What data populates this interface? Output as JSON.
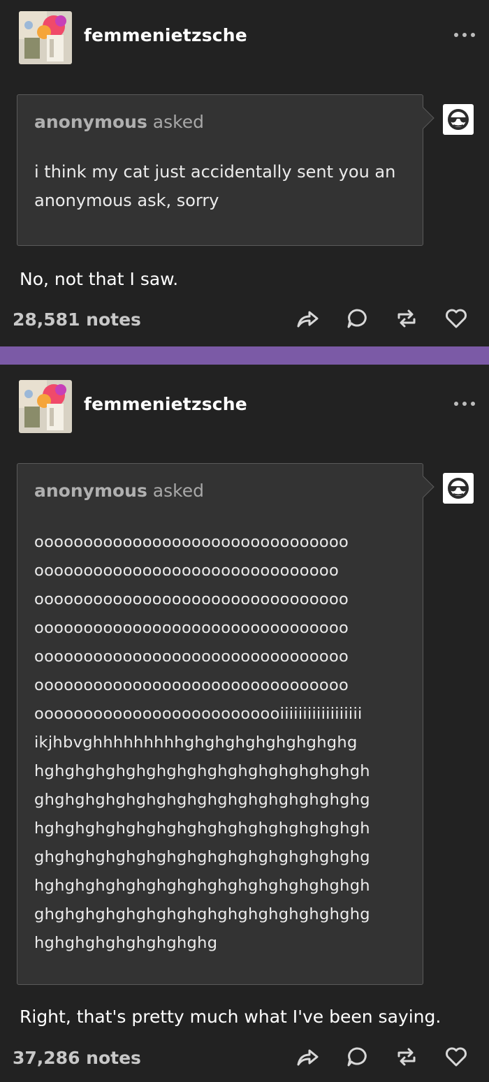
{
  "posts": [
    {
      "username": "femmenietzsche",
      "asker": "anonymous",
      "asked_word": "asked",
      "question_lines": [
        "i think my cat just accidentally sent you an",
        "anonymous ask, sorry"
      ],
      "answer": "No, not that I saw.",
      "notes": "28,581 notes"
    },
    {
      "username": "femmenietzsche",
      "asker": "anonymous",
      "asked_word": "asked",
      "question_lines": [
        "oooooooooooooooooooooooooooooooo",
        "ooooooooooooooooooooooooooooooo",
        "oooooooooooooooooooooooooooooooo",
        "oooooooooooooooooooooooooooooooo",
        "oooooooooooooooooooooooooooooooo",
        "oooooooooooooooooooooooooooooooo",
        "oooooooooooooooooooooooooiiiiiiiiiiiiiiiiii",
        "ikjhbvghhhhhhhhhghghghghghghghghg",
        "hghghghghghghghghghghghghghghghgh",
        "ghghghghghghghghghghghghghghghghg",
        "hghghghghghghghghghghghghghghghgh",
        "ghghghghghghghghghghghghghghghghg",
        "hghghghghghghghghghghghghghghghgh",
        "ghghghghghghghghghghghghghghghghg",
        "hghghghghghghghghg"
      ],
      "answer": "Right, that's pretty much what I've been saying.",
      "notes": "37,286 notes"
    }
  ],
  "icons": {
    "more": "more-options-icon",
    "share": "share-icon",
    "reply": "reply-icon",
    "reblog": "reblog-icon",
    "like": "heart-icon",
    "anon": "anonymous-sunglasses-icon"
  },
  "colors": {
    "background": "#222222",
    "divider": "#7b5aa6",
    "ask_box": "#333333"
  }
}
